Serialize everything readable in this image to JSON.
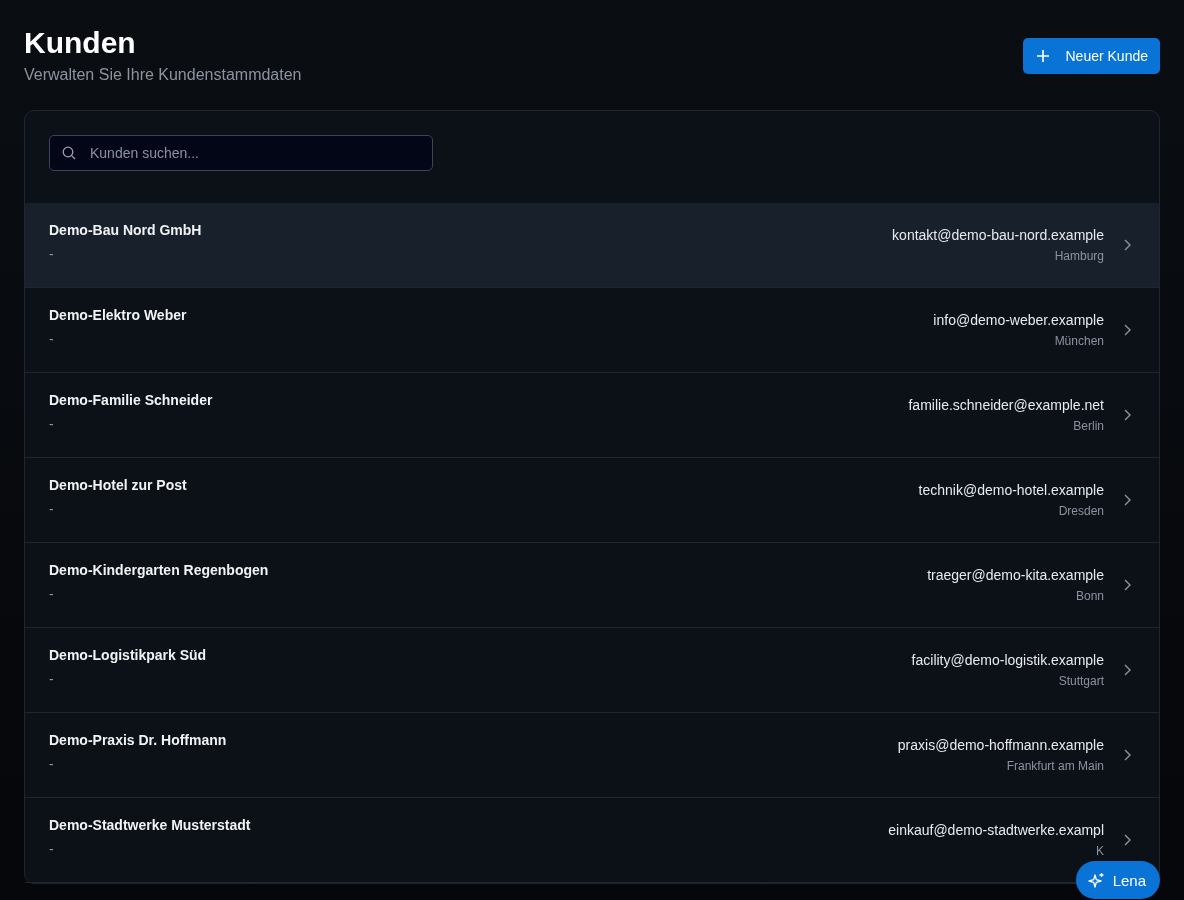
{
  "header": {
    "title": "Kunden",
    "subtitle": "Verwalten Sie Ihre Kundenstammdaten",
    "new_button": "Neuer Kunde"
  },
  "search": {
    "placeholder": "Kunden suchen..."
  },
  "customers": [
    {
      "name": "Demo-Bau Nord GmbH",
      "detail": "-",
      "email": "kontakt@demo-bau-nord.example",
      "city": "Hamburg",
      "selected": true
    },
    {
      "name": "Demo-Elektro Weber",
      "detail": "-",
      "email": "info@demo-weber.example",
      "city": "München",
      "selected": false
    },
    {
      "name": "Demo-Familie Schneider",
      "detail": "-",
      "email": "familie.schneider@example.net",
      "city": "Berlin",
      "selected": false
    },
    {
      "name": "Demo-Hotel zur Post",
      "detail": "-",
      "email": "technik@demo-hotel.example",
      "city": "Dresden",
      "selected": false
    },
    {
      "name": "Demo-Kindergarten Regenbogen",
      "detail": "-",
      "email": "traeger@demo-kita.example",
      "city": "Bonn",
      "selected": false
    },
    {
      "name": "Demo-Logistikpark Süd",
      "detail": "-",
      "email": "facility@demo-logistik.example",
      "city": "Stuttgart",
      "selected": false
    },
    {
      "name": "Demo-Praxis Dr. Hoffmann",
      "detail": "-",
      "email": "praxis@demo-hoffmann.example",
      "city": "Frankfurt am Main",
      "selected": false
    },
    {
      "name": "Demo-Stadtwerke Musterstadt",
      "detail": "-",
      "email": "einkauf@demo-stadtwerke.exampl",
      "city": "K",
      "selected": false
    }
  ],
  "assistant": {
    "label": "Lena"
  }
}
